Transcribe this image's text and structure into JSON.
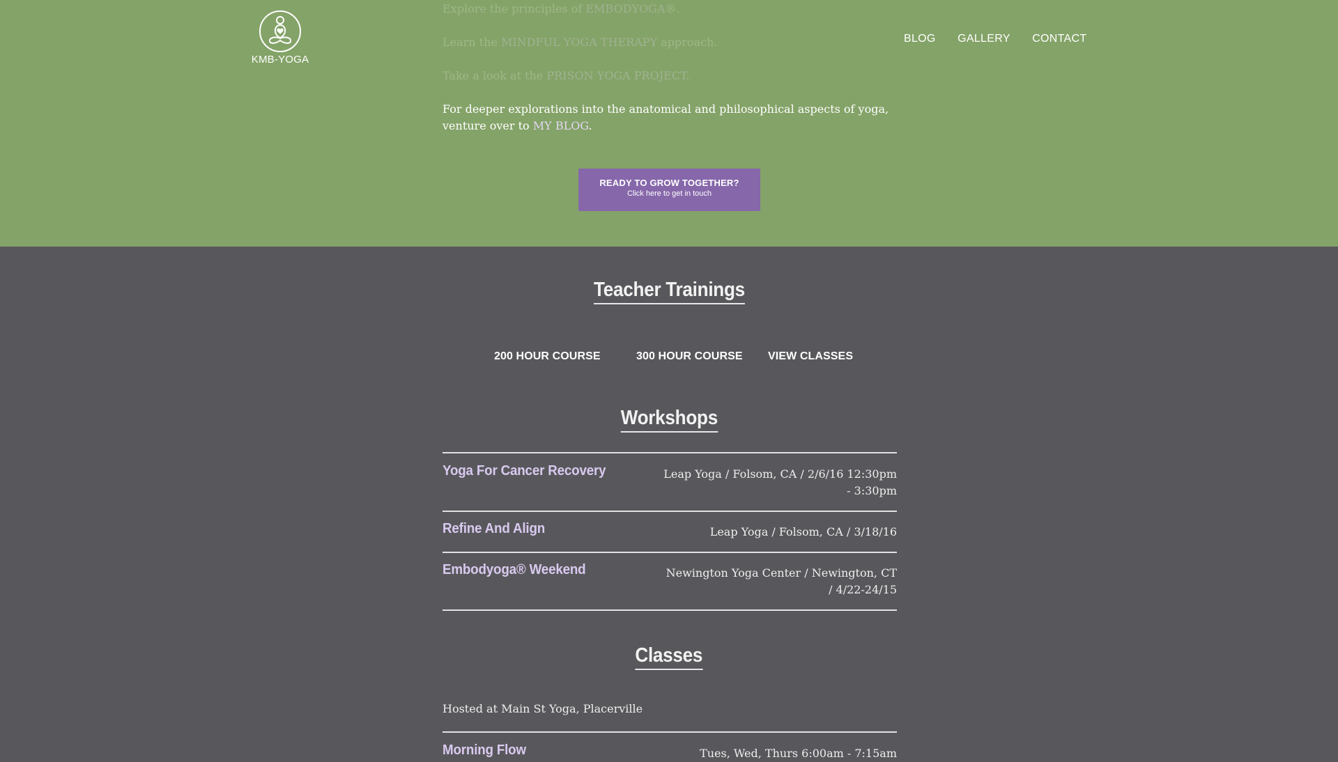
{
  "brand": {
    "name": "KMB-YOGA",
    "logo_icon": "meditating-figure-icon"
  },
  "nav": {
    "items": [
      "BLOG",
      "GALLERY",
      "CONTACT"
    ]
  },
  "hero": {
    "lines": [
      {
        "prefix": "Explore the principles of ",
        "link": "EMBODYOGA",
        "suffix": "®."
      },
      {
        "prefix": "Learn the ",
        "link": "MINDFUL YOGA THERAPY",
        "suffix": " approach."
      },
      {
        "prefix": "Take a look at the ",
        "link": "PRISON YOGA PROJECT",
        "suffix": "."
      }
    ],
    "blog_line": {
      "prefix": "For deeper explorations into the anatomical and philosophical aspects of yoga, venture over to ",
      "link": "MY BLOG",
      "suffix": "."
    },
    "cta": {
      "title": "READY TO GROW TOGETHER?",
      "subtitle": "Click here to get in touch"
    }
  },
  "teacher_trainings": {
    "title": "Teacher Trainings",
    "links": [
      "200 HOUR COURSE",
      "300 HOUR COURSE",
      "VIEW CLASSES"
    ]
  },
  "workshops": {
    "title": "Workshops",
    "items": [
      {
        "name": "Yoga For Cancer Recovery",
        "details": "Leap Yoga / Folsom, CA / 2/6/16 12:30pm - 3:30pm"
      },
      {
        "name": "Refine And Align",
        "details": "Leap Yoga / Folsom, CA / 3/18/16"
      },
      {
        "name": "Embodyoga® Weekend",
        "details": "Newington Yoga Center / Newington, CT / 4/22-24/15"
      }
    ]
  },
  "classes": {
    "title": "Classes",
    "hosted": "Hosted at Main St Yoga, Placerville",
    "items": [
      {
        "name": "Morning Flow",
        "details": "Tues, Wed, Thurs 6:00am - 7:15am"
      }
    ]
  },
  "colors": {
    "hero_bg": "#84a368",
    "body_bg": "#58585c",
    "accent_purple": "#8667aa",
    "title_lavender": "#d9c9ef"
  }
}
